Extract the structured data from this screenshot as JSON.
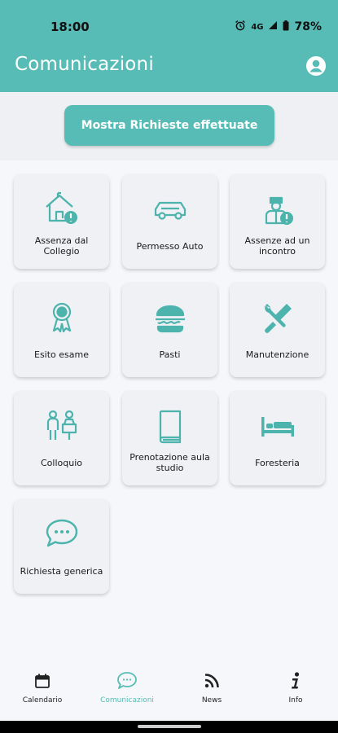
{
  "status_bar": {
    "time": "18:00",
    "network": "4G",
    "battery": "78%"
  },
  "app_bar": {
    "title": "Comunicazioni"
  },
  "main": {
    "show_requests_label": "Mostra Richieste effettuate",
    "cards": [
      {
        "label": "Assenza dal Collegio",
        "icon": "house-alert-icon"
      },
      {
        "label": "Permesso Auto",
        "icon": "car-icon"
      },
      {
        "label": "Assenze ad un incontro",
        "icon": "person-alert-icon"
      },
      {
        "label": "Esito esame",
        "icon": "award-ribbon-icon"
      },
      {
        "label": "Pasti",
        "icon": "burger-icon"
      },
      {
        "label": "Manutenzione",
        "icon": "tools-icon"
      },
      {
        "label": "Colloquio",
        "icon": "meeting-icon"
      },
      {
        "label": "Prenotazione aula studio",
        "icon": "book-icon"
      },
      {
        "label": "Foresteria",
        "icon": "bed-icon"
      },
      {
        "label": "Richiesta generica",
        "icon": "chat-bubble-icon"
      }
    ]
  },
  "bottom_nav": {
    "items": [
      {
        "label": "Calendario",
        "icon": "calendar-icon"
      },
      {
        "label": "Comunicazioni",
        "icon": "chat-icon",
        "active": true
      },
      {
        "label": "News",
        "icon": "rss-icon"
      },
      {
        "label": "Info",
        "icon": "info-icon"
      }
    ]
  },
  "colors": {
    "primary": "#56bcb5",
    "icon": "#4cb3ad",
    "background": "#f5f7fa",
    "card": "#eff1f4"
  }
}
